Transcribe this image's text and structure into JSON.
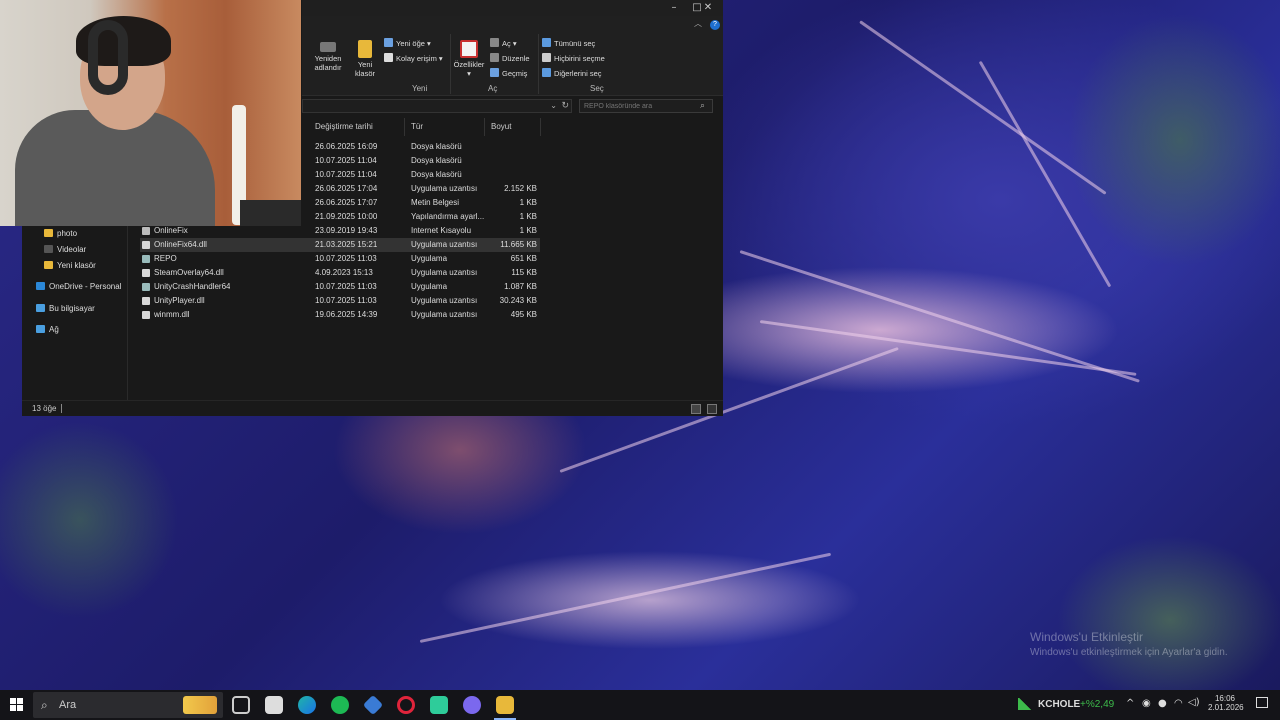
{
  "ribbon": {
    "rename_label_1": "Yeniden",
    "rename_label_2": "adlandır",
    "new_folder_label_1": "Yeni",
    "new_folder_label_2": "klasör",
    "new_item": "Yeni öğe",
    "easy_access": "Kolay erişim",
    "group_new": "Yeni",
    "properties": "Özellikler",
    "open": "Aç",
    "edit": "Düzenle",
    "history": "Geçmiş",
    "group_open": "Aç",
    "select_all": "Tümünü seç",
    "select_none": "Hiçbirini seçme",
    "invert_selection": "Diğerlerini seç",
    "group_select": "Seç"
  },
  "search": {
    "placeholder": "REPO klasöründe ara"
  },
  "columns": {
    "date": "Değiştirme tarihi",
    "type": "Tür",
    "size": "Boyut"
  },
  "nav": [
    {
      "label": "photo",
      "icon": "folder-icon"
    },
    {
      "label": "Videolar",
      "icon": "videos-icon"
    },
    {
      "label": "Yeni klasör",
      "icon": "folder-icon"
    },
    {
      "label": "OneDrive - Personal",
      "icon": "onedrive-icon"
    },
    {
      "label": "Bu bilgisayar",
      "icon": "computer-icon"
    },
    {
      "label": "Ağ",
      "icon": "network-icon"
    }
  ],
  "files": [
    {
      "name": "",
      "date": "26.06.2025 16:09",
      "type": "Dosya klasörü",
      "size": ""
    },
    {
      "name": "",
      "date": "10.07.2025 11:04",
      "type": "Dosya klasörü",
      "size": ""
    },
    {
      "name": "",
      "date": "10.07.2025 11:04",
      "type": "Dosya klasörü",
      "size": ""
    },
    {
      "name": "",
      "date": "26.06.2025 17:04",
      "type": "Uygulama uzantısı",
      "size": "2.152 KB"
    },
    {
      "name": "",
      "date": "26.06.2025 17:07",
      "type": "Metin Belgesi",
      "size": "1 KB"
    },
    {
      "name": "",
      "date": "21.09.2025 10:00",
      "type": "Yapılandırma ayarl...",
      "size": "1 KB"
    },
    {
      "name": "OnlineFix",
      "date": "23.09.2019 19:43",
      "type": "Internet Kısayolu",
      "size": "1 KB"
    },
    {
      "name": "OnlineFix64.dll",
      "date": "21.03.2025 15:21",
      "type": "Uygulama uzantısı",
      "size": "11.665 KB"
    },
    {
      "name": "REPO",
      "date": "10.07.2025 11:03",
      "type": "Uygulama",
      "size": "651 KB"
    },
    {
      "name": "SteamOverlay64.dll",
      "date": "4.09.2023 15:13",
      "type": "Uygulama uzantısı",
      "size": "115 KB"
    },
    {
      "name": "UnityCrashHandler64",
      "date": "10.07.2025 11:03",
      "type": "Uygulama",
      "size": "1.087 KB"
    },
    {
      "name": "UnityPlayer.dll",
      "date": "10.07.2025 11:03",
      "type": "Uygulama uzantısı",
      "size": "30.243 KB"
    },
    {
      "name": "winmm.dll",
      "date": "19.06.2025 14:39",
      "type": "Uygulama uzantısı",
      "size": "495 KB"
    }
  ],
  "status": {
    "count": "13 öğe"
  },
  "watermark": {
    "line1": "Windows'u Etkinleştir",
    "line2": "Windows'u etkinleştirmek için Ayarlar'a gidin."
  },
  "taskbar": {
    "search_label": "Ara",
    "stock_name": "KCHOLE",
    "stock_change": "+%2,49",
    "time": "16:06",
    "date": "2.01.2026"
  },
  "colors": {
    "accent": "#0078d4",
    "taskbar": "#141418",
    "explorer_bg": "#191919",
    "stock_up": "#3dbb4b"
  }
}
